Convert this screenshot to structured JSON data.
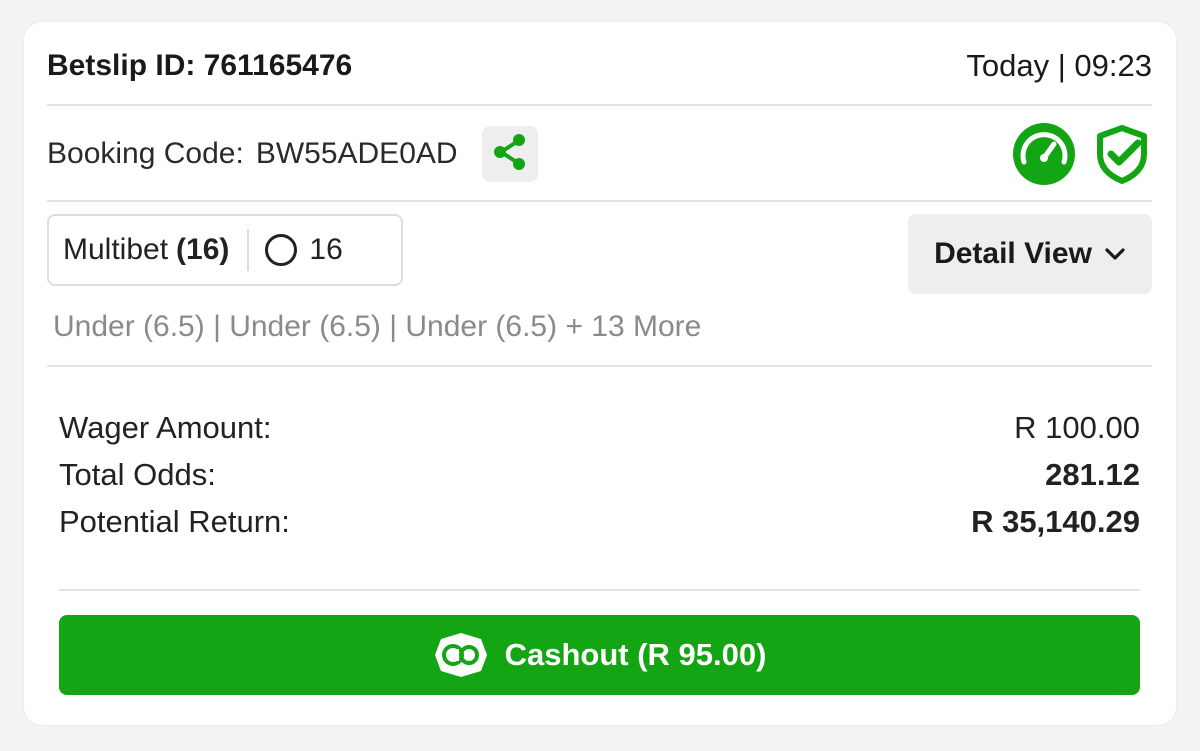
{
  "header": {
    "betslip_id": "Betslip ID: 761165476",
    "datetime": "Today | 09:23"
  },
  "booking": {
    "label": "Booking Code:",
    "code": "BW55ADE0AD"
  },
  "icons": {
    "share": "share-icon",
    "speedometer": "speedometer-icon",
    "shield": "shield-check-icon"
  },
  "multibet": {
    "label": "Multibet",
    "count": "(16)",
    "open_count": "16"
  },
  "detail_view": {
    "label": "Detail View"
  },
  "selections_summary": "Under (6.5) | Under (6.5) | Under (6.5)  + 13 More",
  "summary": {
    "wager_label": "Wager Amount:",
    "wager_value": "R 100.00",
    "odds_label": "Total Odds:",
    "odds_value": "281.12",
    "return_label": "Potential Return:",
    "return_value": "R 35,140.29"
  },
  "cashout": {
    "label": "Cashout (R 95.00)"
  },
  "colors": {
    "accent": "#14a514",
    "background": "#f3f3f3",
    "card": "#ffffff"
  }
}
